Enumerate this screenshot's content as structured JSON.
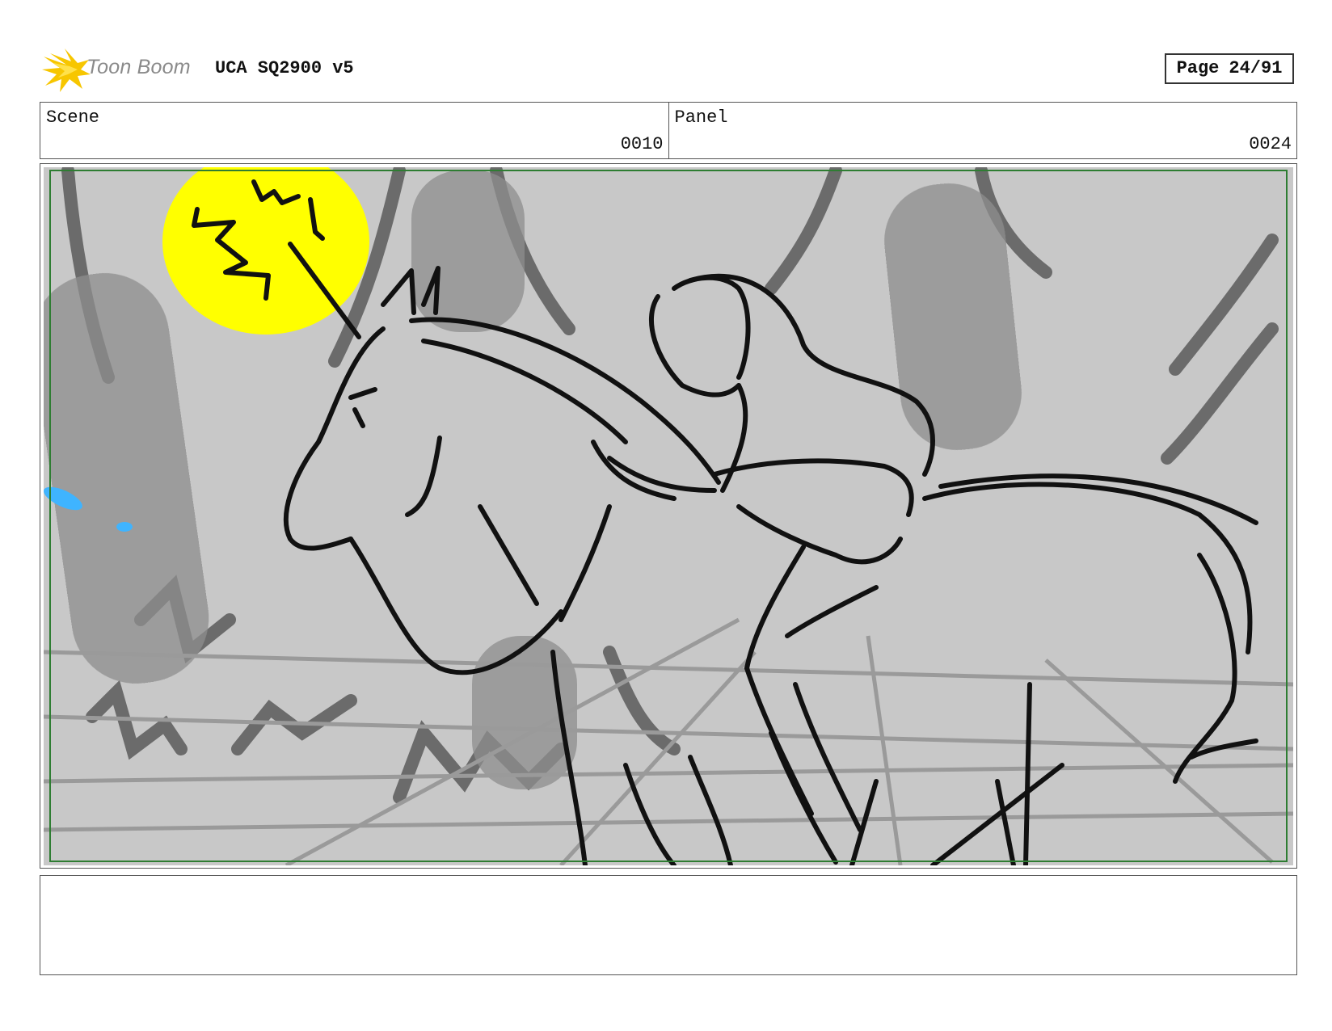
{
  "header": {
    "brand": "Toon Boom",
    "project_title": "UCA SQ2900 v5",
    "page_label": "Page",
    "page_number": "24/91"
  },
  "info": {
    "scene_label": "Scene",
    "scene_value": "0010",
    "panel_label": "Panel",
    "panel_value": "0024"
  },
  "notes": {
    "text": ""
  },
  "colors": {
    "safe_frame": "#2e7d32",
    "sun": "#ffff00",
    "sky_accent": "#3fb4ff",
    "panel_bg": "#c8c8c8"
  }
}
